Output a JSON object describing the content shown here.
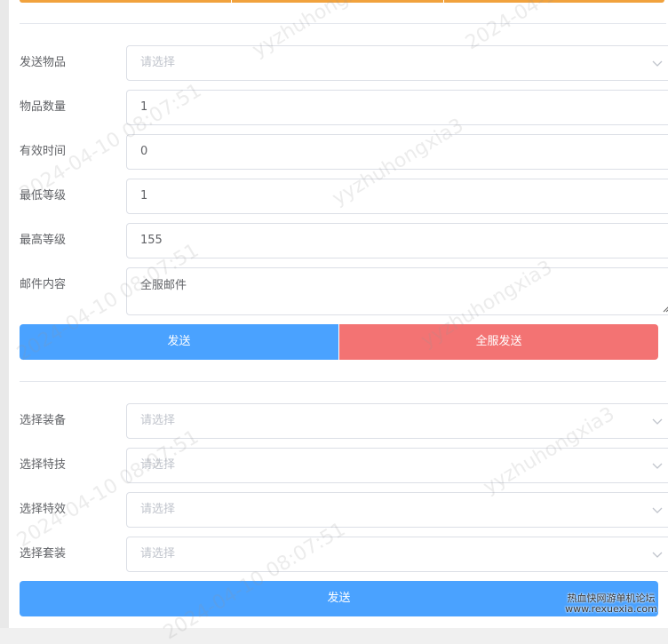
{
  "form1": {
    "send_item_label": "发送物品",
    "send_item_placeholder": "请选择",
    "qty_label": "物品数量",
    "qty_value": "1",
    "valid_time_label": "有效时间",
    "valid_time_value": "0",
    "min_level_label": "最低等级",
    "min_level_value": "1",
    "max_level_label": "最高等级",
    "max_level_value": "155",
    "mail_content_label": "邮件内容",
    "mail_content_value": "全服邮件",
    "send_button": "发送",
    "send_all_button": "全服发送"
  },
  "form2": {
    "equip_label": "选择装备",
    "equip_placeholder": "请选择",
    "skill_label": "选择特技",
    "skill_placeholder": "请选择",
    "effect_label": "选择特效",
    "effect_placeholder": "请选择",
    "suit_label": "选择套装",
    "suit_placeholder": "请选择",
    "send_button": "发送"
  },
  "watermark": {
    "user": "yyzhuhongxia3",
    "datetime": "2024-04-10 08:07:51"
  },
  "site_badge": {
    "line1": "热血快网游单机论坛",
    "line2": "www.rexuexia.com"
  },
  "colors": {
    "primary": "#4aa2ff",
    "danger": "#f37373",
    "top_strip": "#f1a23d"
  }
}
